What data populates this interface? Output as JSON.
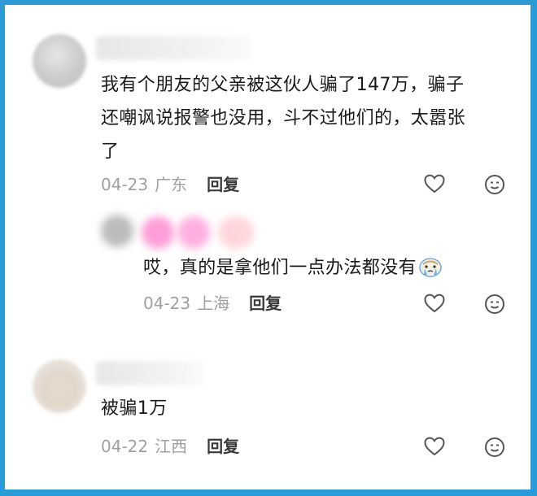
{
  "comments": [
    {
      "text": "我有个朋友的父亲被这伙人骗了147万，骗子\n还嘲讽说报警也没用，斗不过他们的，太嚣张\n了",
      "date": "04-23",
      "location": "广东",
      "reply_label": "回复"
    },
    {
      "text": "哎，真的是拿他们一点办法都没有",
      "emoji": "crying-face-emoji",
      "date": "04-23",
      "location": "上海",
      "reply_label": "回复"
    },
    {
      "text": "被骗1万",
      "date": "04-22",
      "location": "江西",
      "reply_label": "回复"
    }
  ],
  "icons": {
    "like": "heart-outline-icon",
    "react": "smiley-face-icon"
  },
  "colors": {
    "border": "#2b9bd8",
    "text": "#1a1a1a",
    "meta": "#a0a0a0",
    "icon": "#555555"
  }
}
